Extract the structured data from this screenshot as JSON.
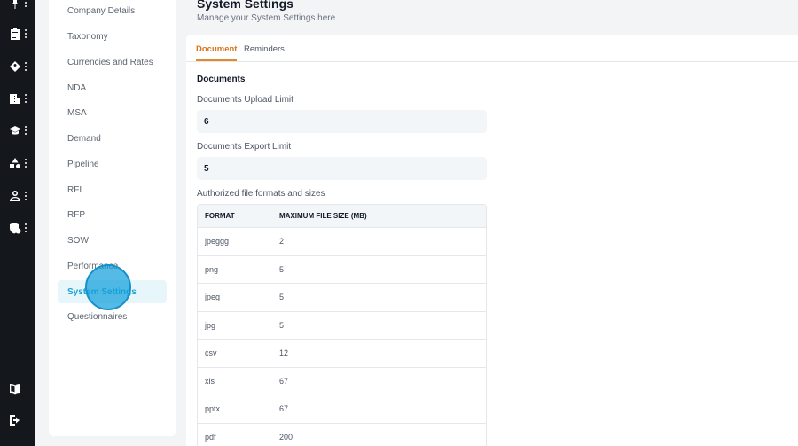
{
  "rail": {
    "items": [
      {
        "icon": "pin-icon"
      },
      {
        "icon": "clipboard-icon"
      },
      {
        "icon": "tag-icon"
      },
      {
        "icon": "building-icon"
      },
      {
        "icon": "graduation-cap-icon"
      },
      {
        "icon": "shapes-icon"
      },
      {
        "icon": "user-icon"
      },
      {
        "icon": "shield-icon"
      }
    ],
    "bottom": [
      {
        "icon": "book-icon"
      },
      {
        "icon": "logout-icon"
      }
    ]
  },
  "subnav": {
    "items": [
      "Company Details",
      "Taxonomy",
      "Currencies and Rates",
      "NDA",
      "MSA",
      "Demand",
      "Pipeline",
      "RFI",
      "RFP",
      "SOW",
      "Performance",
      "System Settings",
      "Questionnaires"
    ],
    "active": "System Settings"
  },
  "page": {
    "title": "System Settings",
    "subtitle": "Manage your System Settings here"
  },
  "tabs": [
    "Document",
    "Reminders"
  ],
  "active_tab": "Document",
  "documents": {
    "section_title": "Documents",
    "upload_limit_label": "Documents Upload Limit",
    "upload_limit_value": "6",
    "export_limit_label": "Documents Export Limit",
    "export_limit_value": "5",
    "formats_label": "Authorized file formats and sizes",
    "table": {
      "headers": [
        "FORMAT",
        "MAXIMUM FILE SIZE (MB)"
      ],
      "rows": [
        {
          "format": "jpeggg",
          "size": "2"
        },
        {
          "format": "png",
          "size": "5"
        },
        {
          "format": "jpeg",
          "size": "5"
        },
        {
          "format": "jpg",
          "size": "5"
        },
        {
          "format": "csv",
          "size": "12"
        },
        {
          "format": "xls",
          "size": "67"
        },
        {
          "format": "pptx",
          "size": "67"
        },
        {
          "format": "pdf",
          "size": "200"
        }
      ]
    }
  },
  "colors": {
    "rail_bg": "#14171c",
    "accent_tab": "#e08a2c",
    "active_nav_text": "#1aa3d4",
    "active_nav_bg": "#e6f6fb"
  }
}
